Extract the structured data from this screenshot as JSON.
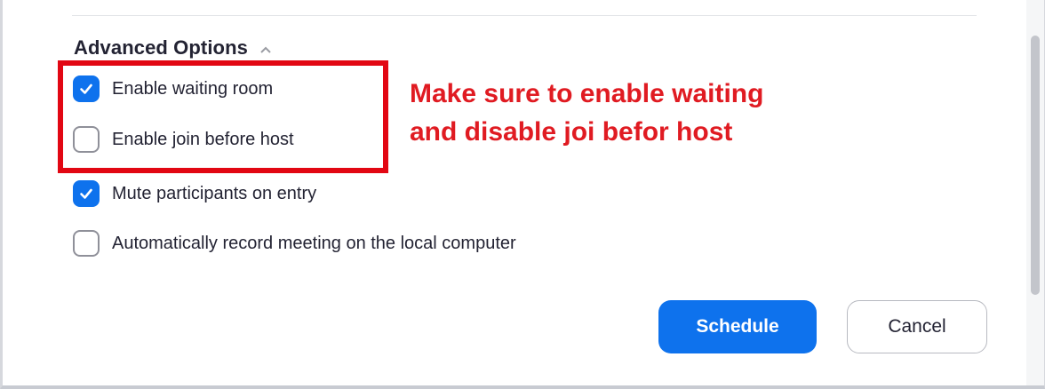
{
  "section": {
    "title": "Advanced Options",
    "icon": "chevron-up-icon"
  },
  "options": [
    {
      "label": "Enable waiting room",
      "checked": true
    },
    {
      "label": "Enable join before host",
      "checked": false
    },
    {
      "label": "Mute participants on entry",
      "checked": true
    },
    {
      "label": "Automatically record meeting on the local computer",
      "checked": false
    }
  ],
  "annotation": {
    "line1": "Make sure to enable waiting",
    "line2": "and disable joi befor host",
    "color": "#e01b22"
  },
  "buttons": {
    "schedule_label": "Schedule",
    "cancel_label": "Cancel"
  },
  "colors": {
    "accent": "#0e72ed",
    "highlight_box": "#e20713"
  }
}
